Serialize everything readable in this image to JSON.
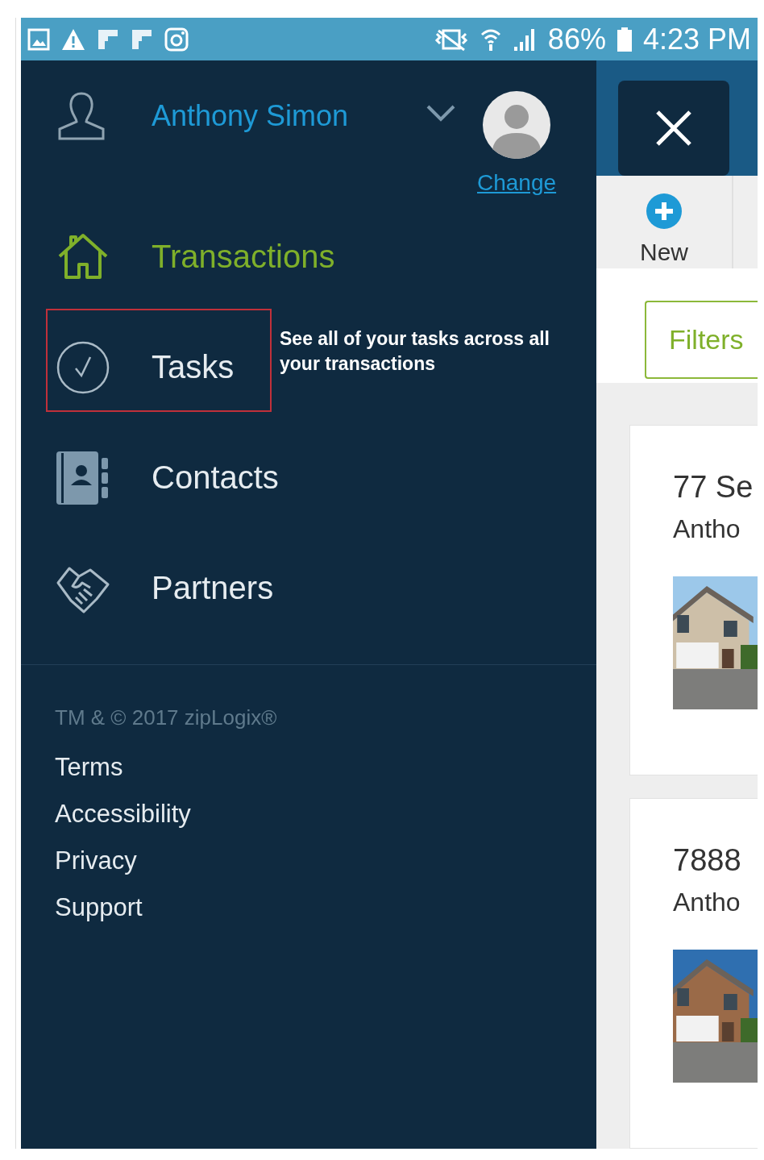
{
  "status_bar": {
    "battery": "86%",
    "time": "4:23 PM"
  },
  "drawer": {
    "user_name": "Anthony Simon",
    "change_link": "Change",
    "menu": [
      {
        "label": "Transactions",
        "kind": "home",
        "selected": true,
        "outlined": false
      },
      {
        "label": "Tasks",
        "kind": "check",
        "selected": false,
        "outlined": true
      },
      {
        "label": "Contacts",
        "kind": "contacts",
        "selected": false,
        "outlined": false
      },
      {
        "label": "Partners",
        "kind": "partners",
        "selected": false,
        "outlined": false
      }
    ],
    "callout": "See all of your tasks across all your transactions",
    "copyright": "TM & © 2017 zipLogix®",
    "links": [
      "Terms",
      "Accessibility",
      "Privacy",
      "Support"
    ]
  },
  "content": {
    "new_button": "New",
    "filters_button": "Filters",
    "cards": [
      {
        "title": "77 Se",
        "subtitle": "Antho"
      },
      {
        "title": "7888",
        "subtitle": "Antho"
      }
    ]
  }
}
